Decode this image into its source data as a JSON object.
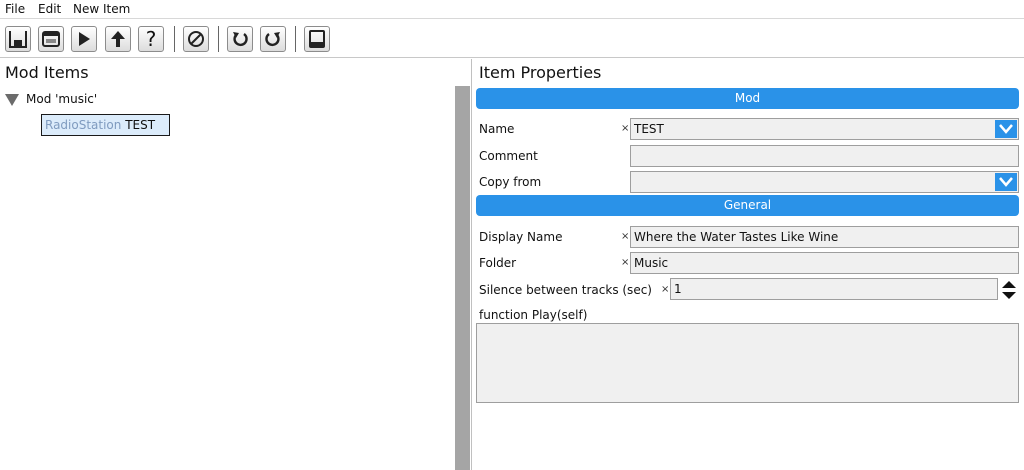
{
  "menu": {
    "file": "File",
    "edit": "Edit",
    "new_item": "New Item"
  },
  "toolbar": {
    "buttons": [
      {
        "icon": "save-icon"
      },
      {
        "icon": "window-icon"
      },
      {
        "icon": "play-icon"
      },
      {
        "icon": "upload-icon"
      },
      {
        "icon": "help-icon",
        "glyph": "?"
      },
      {
        "icon": "disable-icon"
      },
      {
        "icon": "undo-icon"
      },
      {
        "icon": "redo-icon"
      },
      {
        "icon": "terminal-icon"
      }
    ]
  },
  "left_panel": {
    "title": "Mod Items",
    "tree": {
      "root_label": "Mod 'music'",
      "item": {
        "type": "RadioStation",
        "name": "TEST"
      }
    }
  },
  "right_panel": {
    "title": "Item Properties",
    "sections": {
      "mod": "Mod",
      "general": "General"
    },
    "fields": {
      "name": {
        "label": "Name",
        "value": "TEST"
      },
      "comment": {
        "label": "Comment",
        "value": ""
      },
      "copy_from": {
        "label": "Copy from",
        "value": ""
      },
      "display_name": {
        "label": "Display Name",
        "value": "Where the Water Tastes Like Wine"
      },
      "folder": {
        "label": "Folder",
        "value": "Music"
      },
      "silence": {
        "label": "Silence between tracks (sec)",
        "value": "1"
      },
      "play_function": {
        "label": "function Play(self)",
        "value": ""
      }
    },
    "clear_mark": "×"
  },
  "colors": {
    "accent": "#2a92e8",
    "selection": "#dcecfb",
    "field_bg": "#f0f0f0",
    "scrollbar": "#a5a5a5"
  }
}
